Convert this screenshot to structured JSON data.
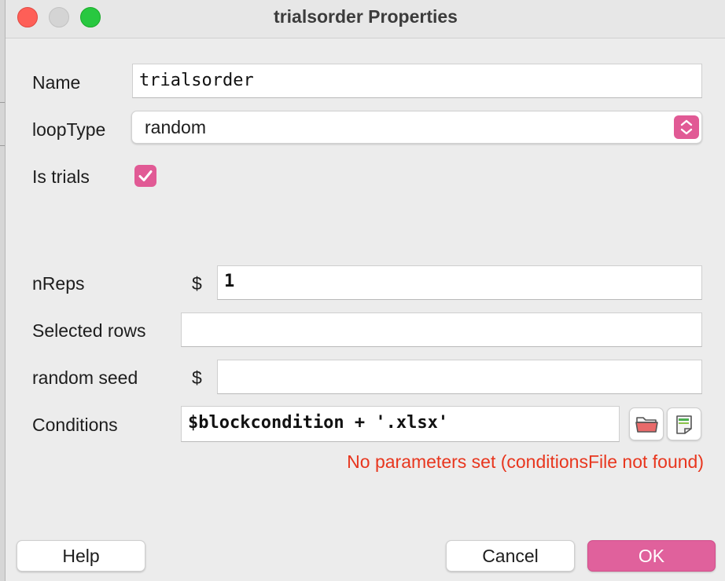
{
  "window": {
    "title": "trialsorder Properties"
  },
  "form": {
    "name": {
      "label": "Name",
      "value": "trialsorder"
    },
    "loopType": {
      "label": "loopType",
      "value": "random"
    },
    "isTrials": {
      "label": "Is trials",
      "checked": true
    },
    "nReps": {
      "label": "nReps",
      "prefix": "$",
      "value": "1"
    },
    "selectedRows": {
      "label": "Selected rows",
      "value": ""
    },
    "randomSeed": {
      "label": "random seed",
      "prefix": "$",
      "value": ""
    },
    "conditions": {
      "label": "Conditions",
      "value": "$blockcondition + '.xlsx'"
    },
    "warning": "No parameters set (conditionsFile not found)"
  },
  "icons": {
    "loopType_stepper": "chevron-up-down-icon",
    "checkbox": "checkmark-icon",
    "conditions_browse": "folder-open-icon",
    "conditions_edit": "spreadsheet-icon"
  },
  "buttons": {
    "help": "Help",
    "cancel": "Cancel",
    "ok": "OK"
  },
  "colors": {
    "accent": "#e15a95",
    "warning": "#e8361e"
  }
}
